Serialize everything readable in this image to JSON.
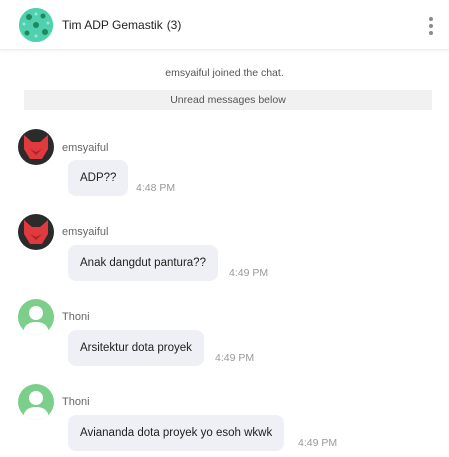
{
  "header": {
    "title": "Tim ADP Gemastik",
    "count": "(3)",
    "faded_text": "emsyaiful joined the chat."
  },
  "system": {
    "joined": "emsyaiful joined the chat.",
    "unread": "Unread messages below"
  },
  "messages": [
    {
      "sender": "emsyaiful",
      "text": "ADP??",
      "time": "4:48 PM",
      "avatar": "red-fox-avatar"
    },
    {
      "sender": "emsyaiful",
      "text": "Anak dangdut pantura??",
      "time": "4:49 PM",
      "avatar": "red-fox-avatar"
    },
    {
      "sender": "Thoni",
      "text": "Arsitektur dota proyek",
      "time": "4:49 PM",
      "avatar": "default-user-avatar"
    },
    {
      "sender": "Thoni",
      "text": "Aviananda dota proyek yo esoh wkwk",
      "time": "4:49 PM",
      "avatar": "default-user-avatar"
    }
  ],
  "colors": {
    "group_avatar": "#4fd1b0",
    "fox_bg": "#2b2b2b",
    "fox": "#e0393e",
    "user_avatar": "#7ccf8a",
    "bubble": "#eef0f5",
    "unread_bar": "#f1f1f1"
  }
}
